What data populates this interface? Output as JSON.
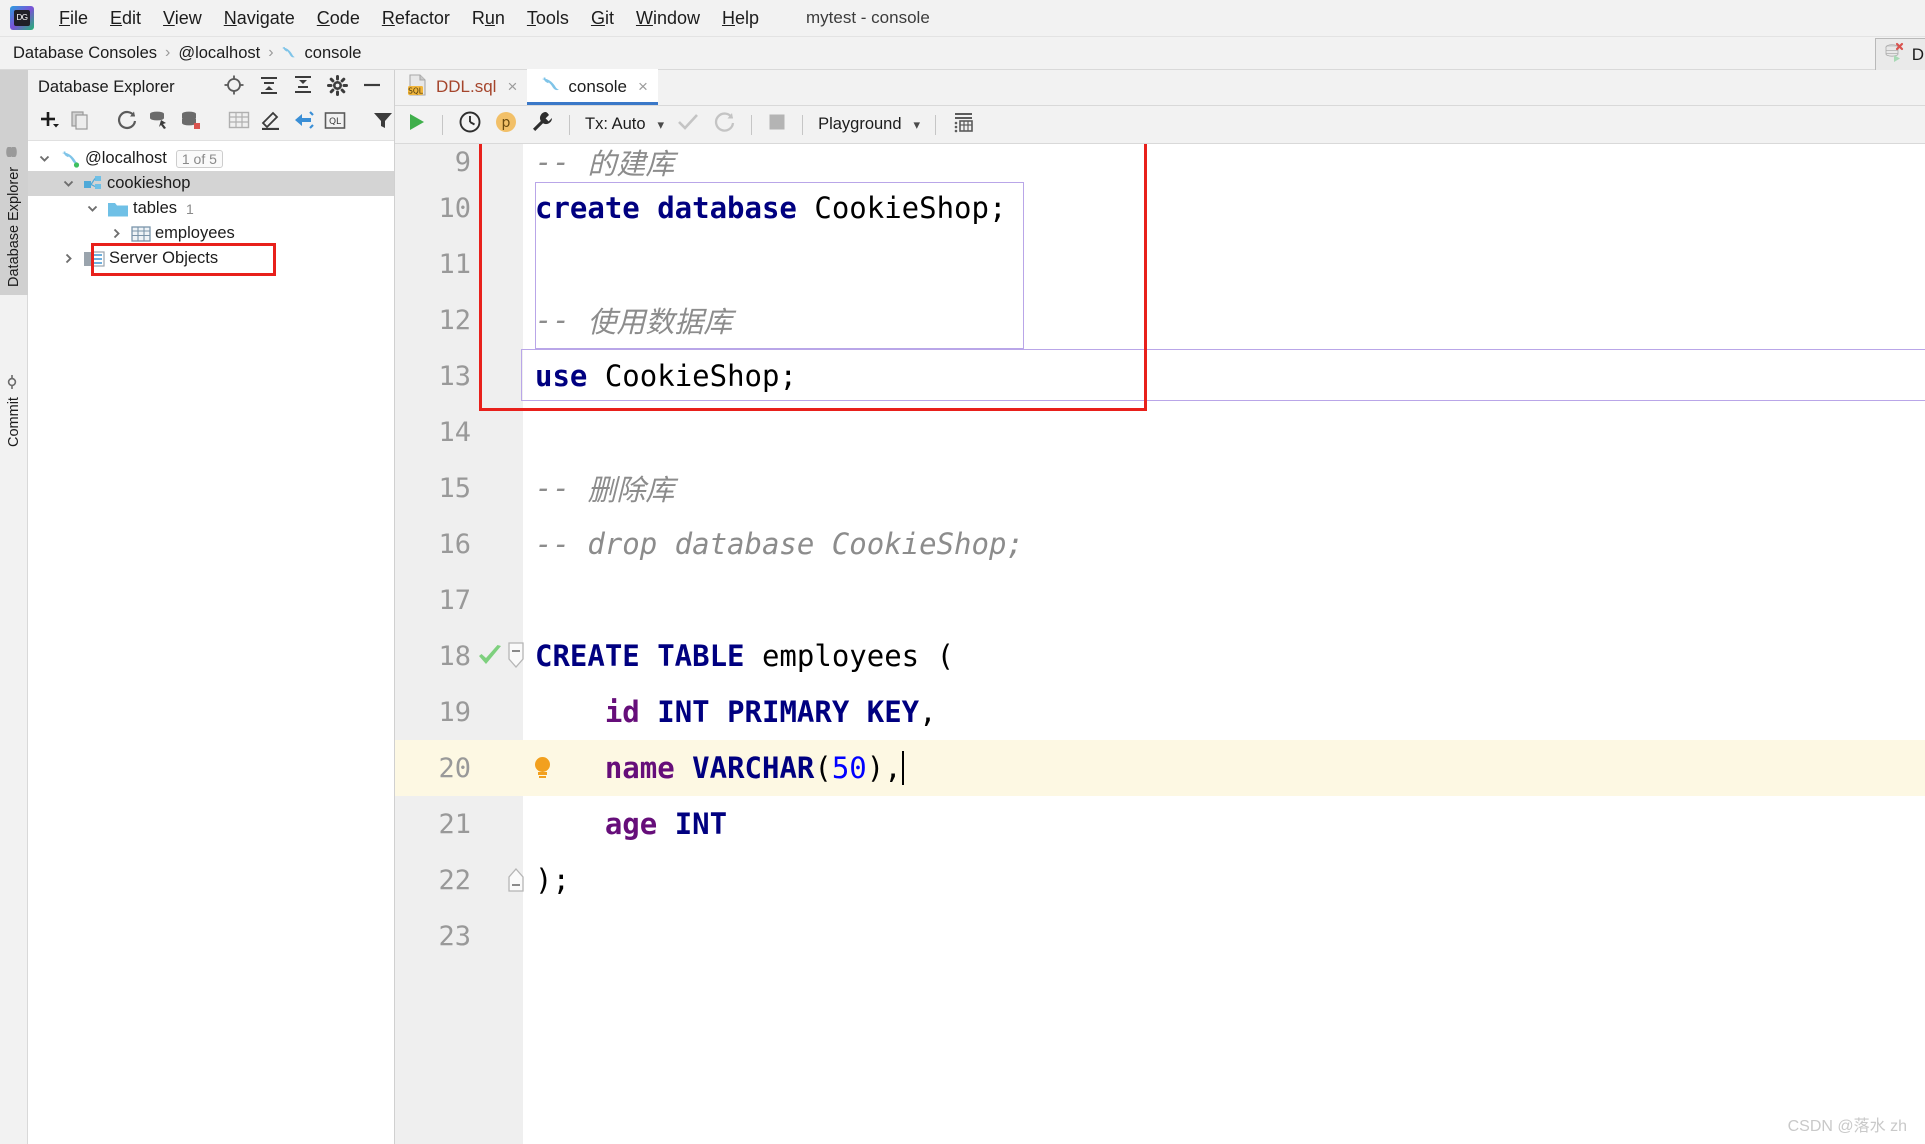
{
  "window": {
    "title": "mytest - console",
    "logo_text": "DG"
  },
  "menubar": {
    "items": [
      {
        "label": "File",
        "mnemonic": "F"
      },
      {
        "label": "Edit",
        "mnemonic": "E"
      },
      {
        "label": "View",
        "mnemonic": "V"
      },
      {
        "label": "Navigate",
        "mnemonic": "N"
      },
      {
        "label": "Code",
        "mnemonic": "C"
      },
      {
        "label": "Refactor",
        "mnemonic": "R"
      },
      {
        "label": "Run",
        "mnemonic": "u"
      },
      {
        "label": "Tools",
        "mnemonic": "T"
      },
      {
        "label": "Git",
        "mnemonic": "G"
      },
      {
        "label": "Window",
        "mnemonic": "W"
      },
      {
        "label": "Help",
        "mnemonic": "H"
      }
    ]
  },
  "breadcrumb": {
    "items": [
      "Database Consoles",
      "@localhost",
      "console"
    ],
    "separator": "›",
    "console_icon": "dolphin-icon"
  },
  "right_widget": {
    "label": "D",
    "icon": "database-disconnect-icon"
  },
  "toolstrip": {
    "tabs": [
      {
        "label": "Database Explorer",
        "icon": "database-icon",
        "active": true
      },
      {
        "label": "Commit",
        "icon": "commit-icon",
        "active": false
      }
    ]
  },
  "database_explorer": {
    "title": "Database Explorer",
    "header_icons": [
      "locate-icon",
      "expand-all-icon",
      "collapse-all-icon",
      "settings-gear-icon",
      "hide-icon"
    ],
    "toolbar_icons": [
      "add-icon",
      "copy-icon",
      "refresh-icon",
      "run-script-icon",
      "database-properties-icon",
      "table-icon",
      "edit-icon",
      "jump-to-icon",
      "query-console-icon",
      "filter-icon"
    ],
    "tree": [
      {
        "label": "@localhost",
        "badge": "1 of 5",
        "icon": "dolphin-icon",
        "chevron": "down",
        "indent": 0,
        "selected": false
      },
      {
        "label": "cookieshop",
        "badge": "",
        "icon": "schema-icon",
        "chevron": "down",
        "indent": 1,
        "selected": true
      },
      {
        "label": "tables",
        "count": "1",
        "icon": "folder-icon",
        "chevron": "down",
        "indent": 2,
        "selected": false
      },
      {
        "label": "employees",
        "badge": "",
        "icon": "table-grid-icon",
        "chevron": "right",
        "indent": 3,
        "selected": false,
        "highlighted": true
      },
      {
        "label": "Server Objects",
        "badge": "",
        "icon": "server-objects-icon",
        "chevron": "right",
        "indent": 1,
        "selected": false
      }
    ]
  },
  "editor": {
    "tabs": [
      {
        "label": "DDL.sql",
        "icon": "sql-file-icon",
        "active": false,
        "close": "×"
      },
      {
        "label": "console",
        "icon": "dolphin-icon",
        "active": true,
        "close": "×"
      }
    ],
    "toolbar": {
      "run_icon": "run-play-icon",
      "history_icon": "history-clock-icon",
      "profile_icon": "profile-p-icon",
      "settings_icon": "wrench-icon",
      "tx_label": "Tx: Auto",
      "commit_icon": "commit-check-icon",
      "rollback_icon": "rollback-icon",
      "stop_icon": "stop-square-icon",
      "schema_label": "Playground",
      "output_icon": "output-table-icon"
    },
    "code_lines": [
      {
        "num": "9",
        "tokens": [
          {
            "t": "-- ",
            "c": "cmt"
          },
          {
            "t": "的建库",
            "c": "cmt"
          }
        ],
        "clipped": true
      },
      {
        "num": "10",
        "tokens": [
          {
            "t": "create database",
            "c": "kw"
          },
          {
            "t": " CookieShop;",
            "c": "plain"
          }
        ]
      },
      {
        "num": "11",
        "tokens": []
      },
      {
        "num": "12",
        "tokens": [
          {
            "t": "-- ",
            "c": "cmt"
          },
          {
            "t": "使用数据库",
            "c": "cmt"
          }
        ]
      },
      {
        "num": "13",
        "tokens": [
          {
            "t": "use",
            "c": "kw"
          },
          {
            "t": " CookieShop;",
            "c": "plain"
          }
        ]
      },
      {
        "num": "14",
        "tokens": []
      },
      {
        "num": "15",
        "tokens": [
          {
            "t": "-- ",
            "c": "cmt"
          },
          {
            "t": "删除库",
            "c": "cmt"
          }
        ]
      },
      {
        "num": "16",
        "tokens": [
          {
            "t": "-- drop database CookieShop;",
            "c": "cmt"
          }
        ]
      },
      {
        "num": "17",
        "tokens": []
      },
      {
        "num": "18",
        "tokens": [
          {
            "t": "CREATE TABLE",
            "c": "kw"
          },
          {
            "t": " employees (",
            "c": "plain"
          }
        ],
        "gutter_icon": "success-check-icon",
        "fold": "start"
      },
      {
        "num": "19",
        "tokens": [
          {
            "t": "    ",
            "c": "plain"
          },
          {
            "t": "id",
            "c": "ident"
          },
          {
            "t": " ",
            "c": "plain"
          },
          {
            "t": "INT PRIMARY KEY",
            "c": "kw"
          },
          {
            "t": ",",
            "c": "plain"
          }
        ]
      },
      {
        "num": "20",
        "tokens": [
          {
            "t": "    ",
            "c": "plain"
          },
          {
            "t": "name",
            "c": "ident"
          },
          {
            "t": " ",
            "c": "plain"
          },
          {
            "t": "VARCHAR",
            "c": "kw"
          },
          {
            "t": "(",
            "c": "plain"
          },
          {
            "t": "50",
            "c": "num"
          },
          {
            "t": "),",
            "c": "plain"
          }
        ],
        "gutter_icon": "lightbulb-icon",
        "highlight": true,
        "caret_end": true
      },
      {
        "num": "21",
        "tokens": [
          {
            "t": "    ",
            "c": "plain"
          },
          {
            "t": "age",
            "c": "ident"
          },
          {
            "t": " ",
            "c": "plain"
          },
          {
            "t": "INT",
            "c": "kw"
          }
        ]
      },
      {
        "num": "22",
        "tokens": [
          {
            "t": ");",
            "c": "plain"
          }
        ],
        "fold": "end"
      },
      {
        "num": "23",
        "tokens": []
      }
    ]
  },
  "watermark": "CSDN @落水 zh",
  "colors": {
    "accent_blue": "#3a78c8",
    "keyword": "#000080",
    "identifier": "#660e7a",
    "number": "#0000ff",
    "comment": "#8c8c8c",
    "annotation_red": "#e8201b",
    "highlight_row": "#fdf8e3",
    "stmt_box": "#b9a6e8",
    "selection": "#d4d4d4"
  }
}
